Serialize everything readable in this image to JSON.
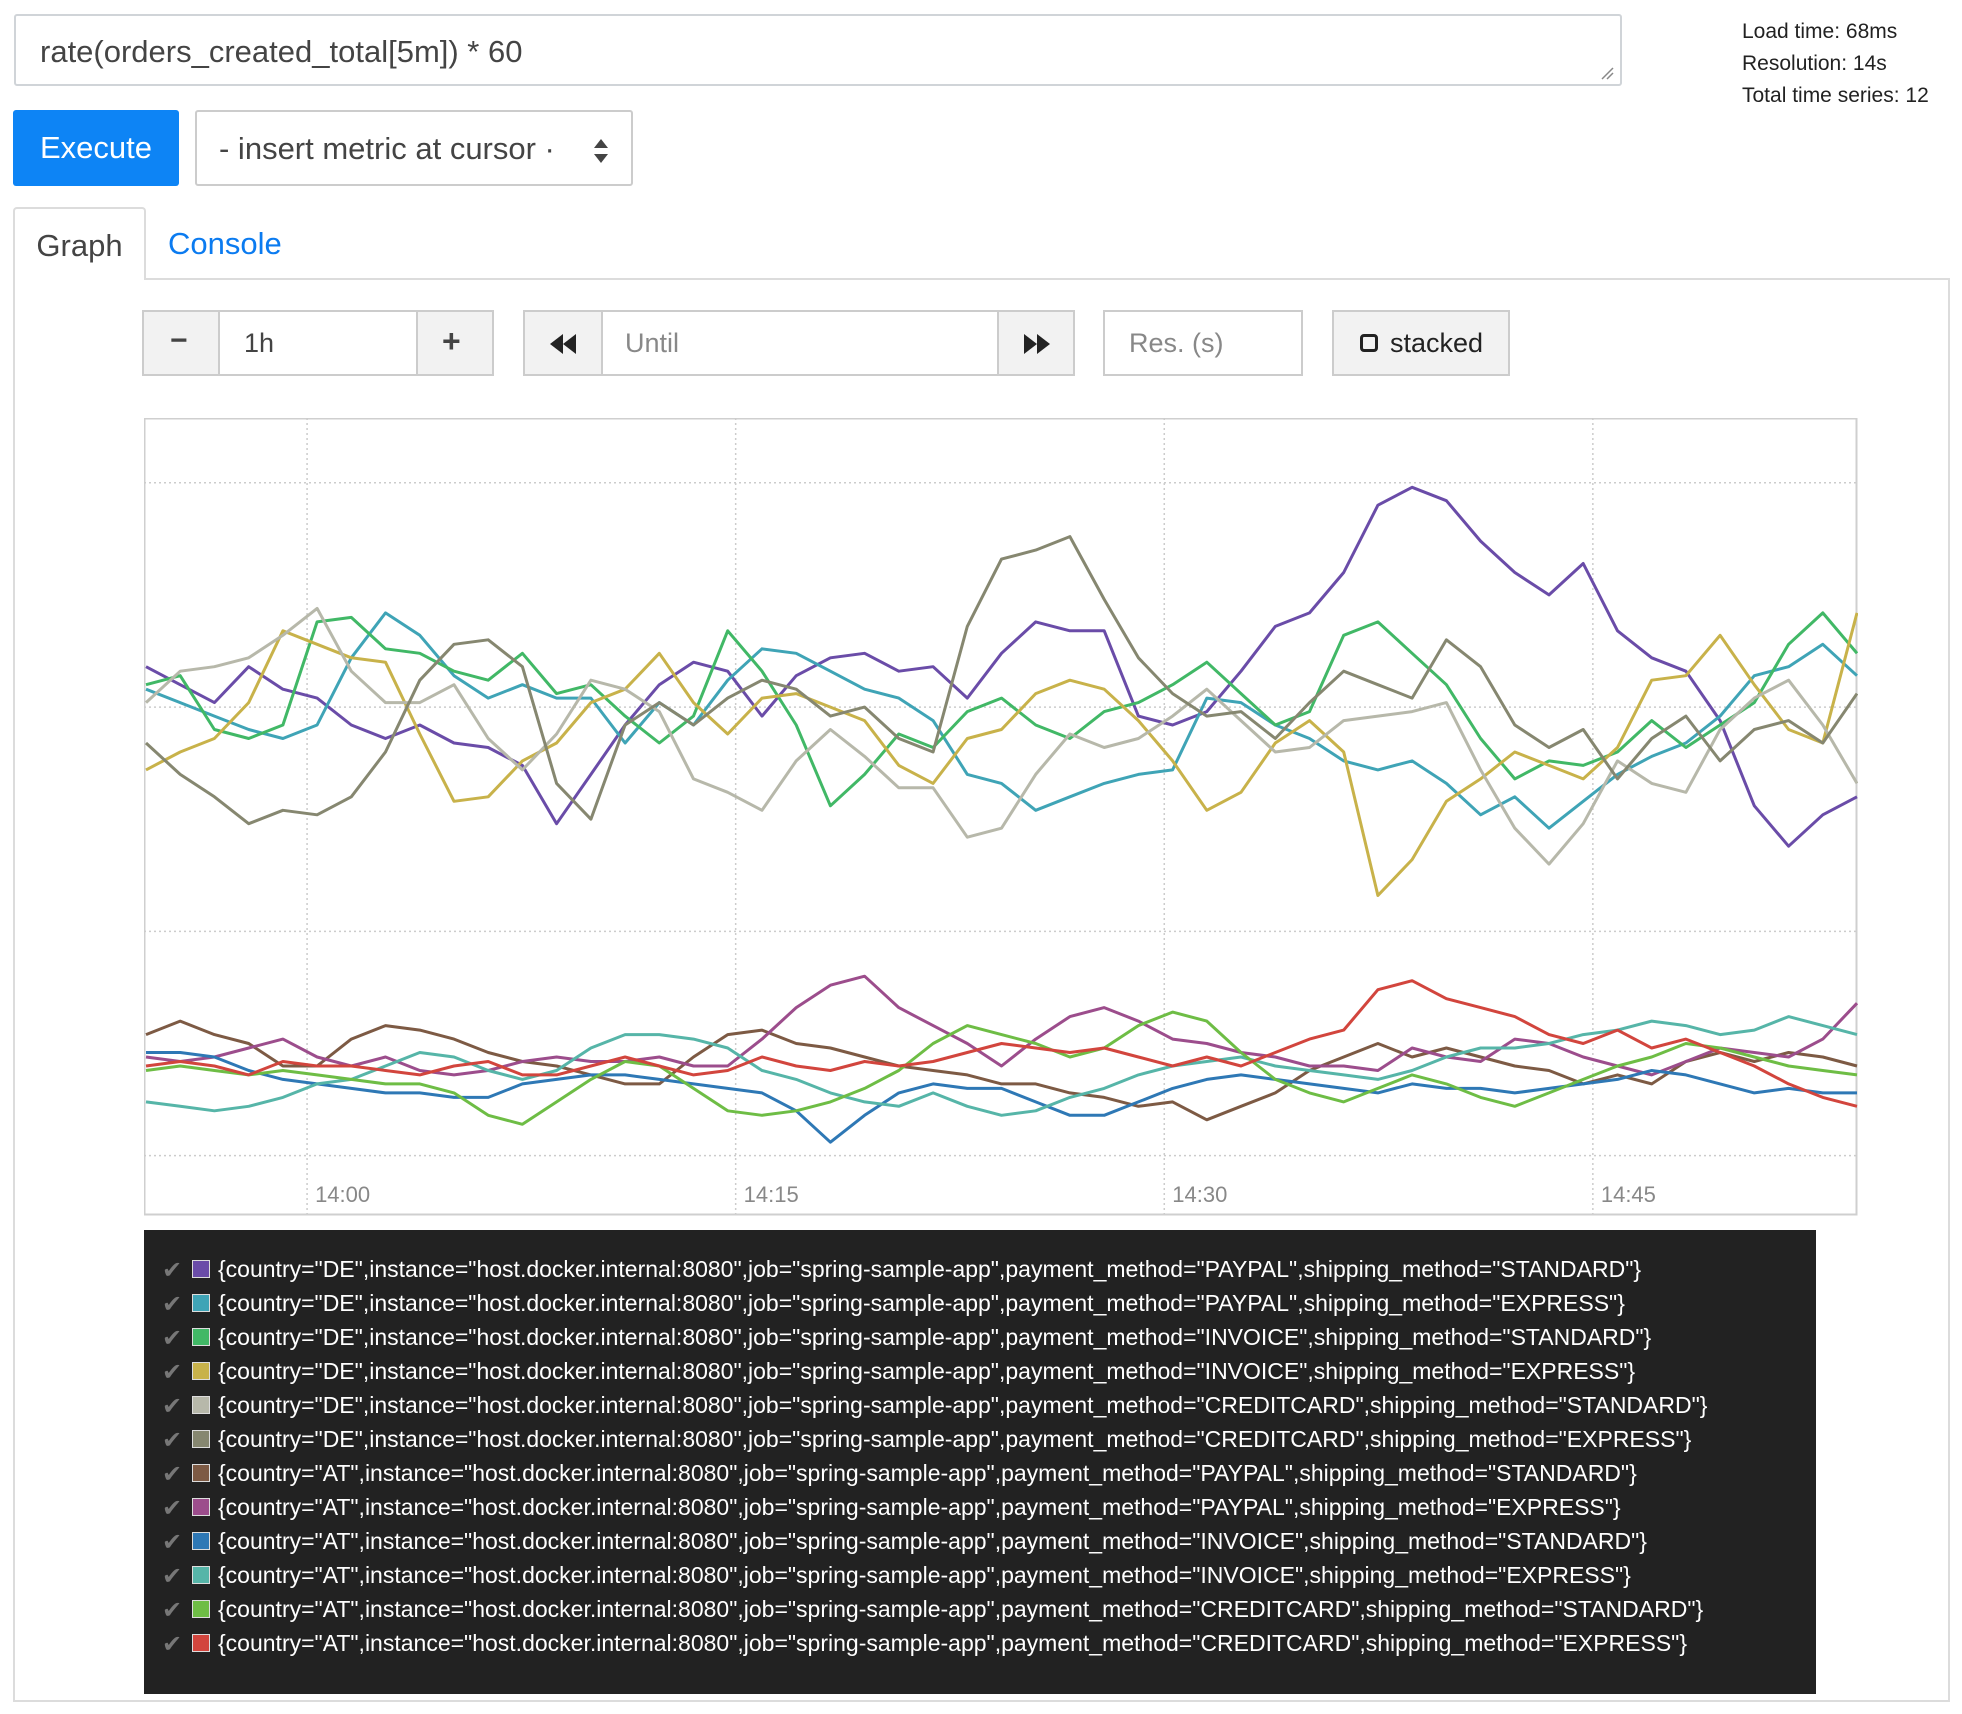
{
  "query": {
    "expression": "rate(orders_created_total[5m]) * 60"
  },
  "stats": {
    "load_time": "Load time: 68ms",
    "resolution": "Resolution: 14s",
    "total_series": "Total time series: 12"
  },
  "toolbar": {
    "execute_label": "Execute",
    "metric_select": "- insert metric at cursor ·"
  },
  "tabs": [
    {
      "label": "Graph",
      "active": true
    },
    {
      "label": "Console",
      "active": false
    }
  ],
  "controls": {
    "minus": "−",
    "range_value": "1h",
    "plus": "+",
    "until_placeholder": "Until",
    "res_placeholder": "Res. (s)",
    "stacked_label": "stacked"
  },
  "chart_data": {
    "type": "line",
    "x_ticks": [
      "14:00",
      "14:15",
      "14:30",
      "14:45"
    ],
    "y_ticks": [
      "0",
      "5",
      "10",
      "15"
    ],
    "ylim": [
      -1.3,
      16.4
    ],
    "grid": true,
    "series": [
      {
        "name": "{country=\"DE\",instance=\"host.docker.internal:8080\",job=\"spring-sample-app\",payment_method=\"PAYPAL\",shipping_method=\"STANDARD\"}",
        "color": "#6a4ca8",
        "values": [
          10.9,
          10.5,
          10.1,
          10.9,
          10.4,
          10.2,
          9.6,
          9.3,
          9.6,
          9.2,
          9.1,
          8.7,
          7.4,
          8.5,
          9.6,
          10.5,
          11.0,
          10.8,
          9.8,
          10.7,
          11.1,
          11.2,
          10.8,
          10.9,
          10.2,
          11.2,
          11.9,
          11.7,
          11.7,
          9.8,
          9.6,
          9.9,
          10.8,
          11.8,
          12.1,
          13.0,
          14.5,
          14.9,
          14.6,
          13.7,
          13.0,
          12.5,
          13.2,
          11.7,
          11.1,
          10.8,
          9.7,
          7.8,
          6.9,
          7.6,
          8.0
        ]
      },
      {
        "name": "{country=\"DE\",instance=\"host.docker.internal:8080\",job=\"spring-sample-app\",payment_method=\"PAYPAL\",shipping_method=\"EXPRESS\"}",
        "color": "#3fa4b6",
        "values": [
          10.4,
          10.1,
          9.8,
          9.5,
          9.3,
          9.6,
          11.1,
          12.1,
          11.6,
          10.7,
          10.2,
          10.5,
          10.2,
          10.2,
          9.2,
          10.1,
          9.6,
          10.6,
          11.3,
          11.2,
          10.8,
          10.4,
          10.2,
          9.7,
          8.5,
          8.3,
          7.7,
          8.0,
          8.3,
          8.5,
          8.6,
          10.2,
          10.1,
          9.6,
          9.3,
          8.8,
          8.6,
          8.8,
          8.3,
          7.6,
          8.0,
          7.3,
          7.9,
          8.5,
          8.9,
          9.2,
          9.8,
          10.7,
          10.9,
          11.4,
          10.7
        ]
      },
      {
        "name": "{country=\"DE\",instance=\"host.docker.internal:8080\",job=\"spring-sample-app\",payment_method=\"INVOICE\",shipping_method=\"STANDARD\"}",
        "color": "#41b866",
        "values": [
          10.5,
          10.7,
          9.5,
          9.3,
          9.6,
          11.9,
          12.0,
          11.3,
          11.2,
          10.8,
          10.6,
          11.2,
          10.3,
          10.5,
          9.8,
          9.2,
          9.8,
          11.7,
          10.8,
          9.6,
          7.8,
          8.5,
          9.4,
          9.1,
          9.9,
          10.2,
          9.6,
          9.3,
          9.9,
          10.1,
          10.5,
          11.0,
          10.3,
          9.6,
          9.9,
          11.6,
          11.9,
          11.2,
          10.5,
          9.3,
          8.4,
          8.8,
          8.7,
          9.0,
          9.7,
          9.1,
          9.6,
          10.1,
          11.4,
          12.1,
          11.2
        ]
      },
      {
        "name": "{country=\"DE\",instance=\"host.docker.internal:8080\",job=\"spring-sample-app\",payment_method=\"INVOICE\",shipping_method=\"EXPRESS\"}",
        "color": "#c8b24a",
        "values": [
          8.6,
          9.0,
          9.3,
          10.1,
          11.7,
          11.4,
          11.1,
          11.0,
          9.4,
          7.9,
          8.0,
          8.8,
          9.2,
          10.1,
          10.4,
          11.2,
          10.1,
          9.4,
          10.2,
          10.3,
          10.0,
          9.7,
          8.7,
          8.3,
          9.3,
          9.5,
          10.3,
          10.6,
          10.4,
          9.7,
          8.8,
          7.7,
          8.1,
          9.2,
          9.7,
          9.0,
          5.8,
          6.6,
          7.9,
          8.4,
          9.0,
          8.7,
          8.4,
          9.1,
          10.6,
          10.7,
          11.6,
          10.5,
          9.5,
          9.2,
          12.1
        ]
      },
      {
        "name": "{country=\"DE\",instance=\"host.docker.internal:8080\",job=\"spring-sample-app\",payment_method=\"CREDITCARD\",shipping_method=\"STANDARD\"}",
        "color": "#b7b8aa",
        "values": [
          10.1,
          10.8,
          10.9,
          11.1,
          11.6,
          12.2,
          10.8,
          10.1,
          10.1,
          10.5,
          9.3,
          8.6,
          9.4,
          10.6,
          10.4,
          9.9,
          8.4,
          8.1,
          7.7,
          8.8,
          9.5,
          8.9,
          8.2,
          8.2,
          7.1,
          7.3,
          8.5,
          9.4,
          9.1,
          9.3,
          9.8,
          10.4,
          9.7,
          9.0,
          9.1,
          9.7,
          9.8,
          9.9,
          10.1,
          8.6,
          7.3,
          6.5,
          7.4,
          8.8,
          8.3,
          8.1,
          9.5,
          10.2,
          10.6,
          9.6,
          8.3
        ]
      },
      {
        "name": "{country=\"DE\",instance=\"host.docker.internal:8080\",job=\"spring-sample-app\",payment_method=\"CREDITCARD\",shipping_method=\"EXPRESS\"}",
        "color": "#868770",
        "values": [
          9.2,
          8.5,
          8.0,
          7.4,
          7.7,
          7.6,
          8.0,
          9.0,
          10.6,
          11.4,
          11.5,
          10.9,
          8.3,
          7.5,
          9.6,
          10.1,
          9.6,
          10.2,
          10.6,
          10.4,
          9.8,
          10.0,
          9.3,
          9.0,
          11.8,
          13.3,
          13.5,
          13.8,
          12.4,
          11.1,
          10.3,
          9.8,
          9.9,
          9.3,
          10.1,
          10.8,
          10.5,
          10.2,
          11.5,
          10.9,
          9.6,
          9.1,
          9.5,
          8.4,
          9.3,
          9.8,
          8.8,
          9.5,
          9.7,
          9.2,
          10.3
        ]
      },
      {
        "name": "{country=\"AT\",instance=\"host.docker.internal:8080\",job=\"spring-sample-app\",payment_method=\"PAYPAL\",shipping_method=\"STANDARD\"}",
        "color": "#7d5a44",
        "values": [
          2.7,
          3.0,
          2.7,
          2.5,
          2.0,
          2.0,
          2.6,
          2.9,
          2.8,
          2.6,
          2.3,
          2.1,
          2.0,
          1.8,
          1.6,
          1.6,
          2.2,
          2.7,
          2.8,
          2.5,
          2.4,
          2.2,
          2.0,
          1.9,
          1.8,
          1.6,
          1.6,
          1.4,
          1.3,
          1.1,
          1.2,
          0.8,
          1.1,
          1.4,
          1.9,
          2.2,
          2.5,
          2.2,
          2.4,
          2.2,
          2.0,
          1.9,
          1.6,
          1.8,
          1.6,
          2.1,
          2.3,
          2.1,
          2.3,
          2.2,
          2.0
        ]
      },
      {
        "name": "{country=\"AT\",instance=\"host.docker.internal:8080\",job=\"spring-sample-app\",payment_method=\"PAYPAL\",shipping_method=\"EXPRESS\"}",
        "color": "#9c4d8c",
        "values": [
          2.2,
          2.1,
          2.2,
          2.4,
          2.6,
          2.2,
          2.0,
          2.2,
          1.9,
          1.8,
          1.9,
          2.1,
          2.2,
          2.1,
          2.1,
          2.2,
          2.0,
          2.0,
          2.6,
          3.3,
          3.8,
          4.0,
          3.3,
          2.9,
          2.5,
          2.0,
          2.6,
          3.1,
          3.3,
          3.0,
          2.6,
          2.5,
          2.3,
          2.2,
          2.0,
          2.0,
          1.9,
          2.4,
          2.2,
          2.1,
          2.6,
          2.5,
          2.2,
          2.0,
          1.8,
          2.1,
          2.4,
          2.3,
          2.2,
          2.6,
          3.4
        ]
      },
      {
        "name": "{country=\"AT\",instance=\"host.docker.internal:8080\",job=\"spring-sample-app\",payment_method=\"INVOICE\",shipping_method=\"STANDARD\"}",
        "color": "#2e78b5",
        "values": [
          2.3,
          2.3,
          2.2,
          1.9,
          1.7,
          1.6,
          1.5,
          1.4,
          1.4,
          1.3,
          1.3,
          1.6,
          1.7,
          1.8,
          1.8,
          1.7,
          1.6,
          1.5,
          1.4,
          1.0,
          0.3,
          0.9,
          1.4,
          1.6,
          1.5,
          1.5,
          1.2,
          0.9,
          0.9,
          1.2,
          1.5,
          1.7,
          1.8,
          1.7,
          1.6,
          1.5,
          1.4,
          1.6,
          1.5,
          1.5,
          1.4,
          1.5,
          1.6,
          1.7,
          1.9,
          1.8,
          1.6,
          1.4,
          1.5,
          1.4,
          1.4
        ]
      },
      {
        "name": "{country=\"AT\",instance=\"host.docker.internal:8080\",job=\"spring-sample-app\",payment_method=\"INVOICE\",shipping_method=\"EXPRESS\"}",
        "color": "#56b5a8",
        "values": [
          1.2,
          1.1,
          1.0,
          1.1,
          1.3,
          1.6,
          1.7,
          2.0,
          2.3,
          2.2,
          1.9,
          1.7,
          1.9,
          2.4,
          2.7,
          2.7,
          2.6,
          2.4,
          1.9,
          1.7,
          1.4,
          1.2,
          1.1,
          1.4,
          1.1,
          0.9,
          1.0,
          1.3,
          1.5,
          1.8,
          2.0,
          2.1,
          2.2,
          2.0,
          1.9,
          1.8,
          1.7,
          1.9,
          2.2,
          2.4,
          2.4,
          2.5,
          2.7,
          2.8,
          3.0,
          2.9,
          2.7,
          2.8,
          3.1,
          2.9,
          2.7
        ]
      },
      {
        "name": "{country=\"AT\",instance=\"host.docker.internal:8080\",job=\"spring-sample-app\",payment_method=\"CREDITCARD\",shipping_method=\"STANDARD\"}",
        "color": "#6ebd45",
        "values": [
          1.9,
          2.0,
          1.9,
          1.8,
          1.9,
          1.8,
          1.7,
          1.6,
          1.6,
          1.4,
          0.9,
          0.7,
          1.2,
          1.7,
          2.1,
          2.0,
          1.5,
          1.0,
          0.9,
          1.0,
          1.2,
          1.5,
          1.9,
          2.5,
          2.9,
          2.7,
          2.5,
          2.2,
          2.4,
          2.9,
          3.2,
          3.0,
          2.3,
          1.7,
          1.4,
          1.2,
          1.5,
          1.8,
          1.6,
          1.3,
          1.1,
          1.4,
          1.7,
          2.0,
          2.2,
          2.5,
          2.4,
          2.2,
          2.0,
          1.9,
          1.8
        ]
      },
      {
        "name": "{country=\"AT\",instance=\"host.docker.internal:8080\",job=\"spring-sample-app\",payment_method=\"CREDITCARD\",shipping_method=\"EXPRESS\"}",
        "color": "#d2453d",
        "values": [
          2.0,
          2.1,
          2.0,
          1.8,
          2.1,
          2.0,
          2.0,
          1.9,
          1.8,
          2.0,
          2.1,
          1.8,
          1.8,
          2.0,
          2.2,
          2.0,
          1.8,
          1.9,
          2.2,
          2.0,
          1.9,
          2.1,
          2.0,
          2.1,
          2.3,
          2.5,
          2.4,
          2.3,
          2.4,
          2.2,
          2.0,
          2.2,
          2.0,
          2.3,
          2.6,
          2.8,
          3.7,
          3.9,
          3.5,
          3.3,
          3.1,
          2.7,
          2.5,
          2.8,
          2.4,
          2.6,
          2.3,
          2.0,
          1.6,
          1.3,
          1.1
        ]
      }
    ]
  }
}
